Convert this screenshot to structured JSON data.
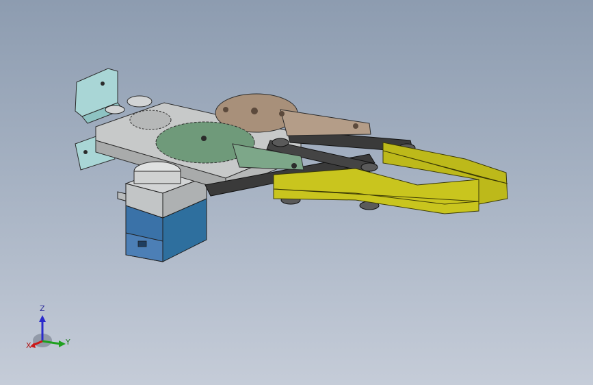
{
  "viewport": {
    "background_top": "#8d9cb0",
    "background_bottom": "#c5ccd8"
  },
  "model": {
    "parts": [
      {
        "name": "mounting-bracket",
        "color": "#a9d6d6"
      },
      {
        "name": "base-plate",
        "color": "#c7c9c9"
      },
      {
        "name": "servo-body",
        "color": "#2e6f9e"
      },
      {
        "name": "drive-gear",
        "color": "#6f9a7a"
      },
      {
        "name": "driven-gear",
        "color": "#a8907a"
      },
      {
        "name": "link-arm",
        "color": "#3a3a3a"
      },
      {
        "name": "gripper-jaw",
        "color": "#c9c51e"
      }
    ]
  },
  "triad": {
    "z_label": "Z",
    "y_label": "Y",
    "x_label": "X",
    "z_color": "#2a2acc",
    "y_color": "#1fa01f",
    "x_color": "#cc1818"
  }
}
